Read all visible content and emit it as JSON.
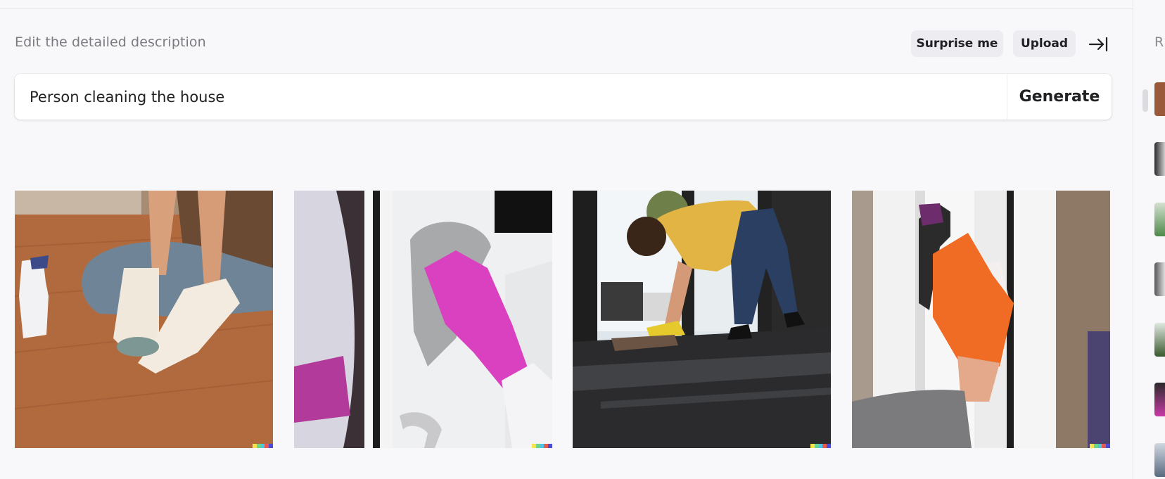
{
  "header": {
    "label": "Edit the detailed description",
    "surprise_label": "Surprise me",
    "upload_label": "Upload",
    "collapse_icon": "collapse-to-right-icon"
  },
  "prompt": {
    "value": "Person cleaning the house",
    "generate_label": "Generate"
  },
  "results": [
    {
      "subject": "gloved hands wiping wooden floor beside spray bottle"
    },
    {
      "subject": "pink-gloved hand wiping glass door with cloth"
    },
    {
      "subject": "woman in yellow shirt mopping dark tiled floor"
    },
    {
      "subject": "orange-gloved hand wiping white door frame"
    }
  ],
  "sidebar": {
    "title": "R",
    "thumbnail_count": 7
  },
  "colors": {
    "background": "#f8f8fa",
    "pill": "#ececf1",
    "text": "#202123",
    "muted": "#7a7a80"
  }
}
